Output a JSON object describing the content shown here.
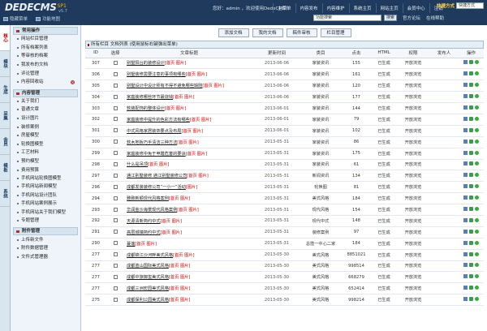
{
  "header": {
    "logo_text": "DEDECMS",
    "logo_version": "v5.7",
    "logo_badge": "SP1",
    "toggles": [
      {
        "label": "隐藏菜单"
      },
      {
        "label": "功能地图"
      }
    ],
    "welcome": "您好：admin ，欢迎使用DedeCMS！",
    "nav": [
      {
        "label": "主菜单"
      },
      {
        "label": "内容发布"
      },
      {
        "label": "内容维护"
      },
      {
        "label": "系统主页"
      },
      {
        "label": "网站主页"
      },
      {
        "label": "会员中心"
      },
      {
        "label": "注销"
      }
    ],
    "quick_label": "快捷方式",
    "quick_value": "快捷方式",
    "search_placeholder": "功能搜索",
    "search_button": "搜索",
    "links": [
      {
        "label": "官方论坛"
      },
      {
        "label": "在线帮助"
      }
    ]
  },
  "lefttabs": [
    {
      "label": "核心"
    },
    {
      "label": "模块"
    },
    {
      "label": "生成"
    },
    {
      "label": "采集"
    },
    {
      "label": "会员"
    },
    {
      "label": "模板"
    },
    {
      "label": "系统"
    }
  ],
  "sidebar": {
    "groups": [
      {
        "title": "常用操作",
        "items": [
          {
            "label": "网站栏目管理"
          },
          {
            "label": "所有档案列表"
          },
          {
            "label": "等审核的档案"
          },
          {
            "label": "我发布的文档"
          },
          {
            "label": "评论管理"
          },
          {
            "label": "内容回收站",
            "badge": "✕"
          }
        ]
      },
      {
        "title": "内容管理",
        "items": [
          {
            "label": "关于我们"
          },
          {
            "label": "普通文章"
          },
          {
            "label": "设计图片"
          },
          {
            "label": "装修案例"
          },
          {
            "label": "房屋模型"
          },
          {
            "label": "轮换图模型"
          },
          {
            "label": "工艺材料"
          },
          {
            "label": "预约模型"
          },
          {
            "label": "费用预算"
          },
          {
            "label": "手机网站轮换图模型"
          },
          {
            "label": "手机网站新闻模型"
          },
          {
            "label": "手机网站设计团队"
          },
          {
            "label": "手机网站案例展示"
          },
          {
            "label": "手机网站关于我们模型"
          },
          {
            "label": "专题管理"
          }
        ]
      },
      {
        "title": "附件管理",
        "items": [
          {
            "label": "上传新文件"
          },
          {
            "label": "附件数据管理"
          },
          {
            "label": "文件式管理器"
          }
        ]
      }
    ]
  },
  "toolbar": {
    "buttons": [
      {
        "label": "添加文档"
      },
      {
        "label": "我的文档"
      },
      {
        "label": "稿件审核"
      },
      {
        "label": "栏目管理"
      }
    ]
  },
  "caption": "所有栏目 文档列表  (使用鼠标右键弹出菜单)",
  "table": {
    "columns": [
      "ID",
      "选择",
      "文章标题",
      "更新时间",
      "类目",
      "点击",
      "HTML",
      "权限",
      "发布人",
      "操作"
    ],
    "rows": [
      {
        "id": "307",
        "title": "别墅阳台的装修设计",
        "tags": "[首页 图片]",
        "date": "2013-06-06",
        "cat": "家装资讯",
        "clicks": "155",
        "html": "已生成",
        "perm": "开放浏览"
      },
      {
        "id": "306",
        "title": "别墅装修需要注意的事项有哪些",
        "tags": "[首页 图片]",
        "date": "2013-06-06",
        "cat": "家装资讯",
        "clicks": "161",
        "html": "已生成",
        "perm": "开放浏览"
      },
      {
        "id": "305",
        "title": "别墅设计中设计师有不得不避免哪些缺陷",
        "tags": "[首页 图片]",
        "date": "2013-06-06",
        "cat": "家装资讯",
        "clicks": "120",
        "html": "已生成",
        "perm": "开放浏览"
      },
      {
        "id": "304",
        "title": "家庭装修哪些环节最烧钱",
        "tags": "[首页 图片]",
        "date": "2013-06-06",
        "cat": "家装资讯",
        "clicks": "177",
        "html": "已生成",
        "perm": "开放浏览"
      },
      {
        "id": "303",
        "title": "软装配饰的整体设计",
        "tags": "[首页 图片]",
        "date": "2013-06-01",
        "cat": "家装资讯",
        "clicks": "144",
        "html": "已生成",
        "perm": "开放浏览"
      },
      {
        "id": "302",
        "title": "家庭装修中提升的色彩方法有哪些",
        "tags": "[首页 图片]",
        "date": "2013-06-01",
        "cat": "家装资讯",
        "clicks": "79",
        "html": "已生成",
        "perm": "开放浏览"
      },
      {
        "id": "301",
        "title": "中式风格家居装饰要点及布局",
        "tags": "[首页 图片]",
        "date": "2013-06-01",
        "cat": "家装资讯",
        "clicks": "102",
        "html": "已生成",
        "perm": "开放浏览"
      },
      {
        "id": "300",
        "title": "软木地板巧手清洁三种方法",
        "tags": "[首页 图片]",
        "date": "2013-05-31",
        "cat": "家装资讯",
        "clicks": "86",
        "html": "已生成",
        "perm": "开放浏览"
      },
      {
        "id": "299",
        "title": "家庭装修中免于甲醛危害的要诀",
        "tags": "[首页 图片]",
        "date": "2013-05-31",
        "cat": "家装资讯",
        "clicks": "175",
        "html": "已生成",
        "perm": "开放浏览"
      },
      {
        "id": "298",
        "title": "什么是吊顶",
        "tags": "[首页 图片]",
        "date": "2013-05-31",
        "cat": "家装资讯",
        "clicks": "61",
        "html": "已生成",
        "perm": "开放浏览"
      },
      {
        "id": "297",
        "title": "通江别墅装修 通江别墅装修公司",
        "tags": "[首页 图片]",
        "date": "2013-05-31",
        "cat": "新闻资讯",
        "clicks": "134",
        "html": "已生成",
        "perm": "开放浏览"
      },
      {
        "id": "296",
        "title": "成都发装装修公司“一小一”活动",
        "tags": "[图片]",
        "date": "2013-05-31",
        "cat": "轮换图",
        "clicks": "81",
        "html": "已生成",
        "perm": "开放浏览"
      },
      {
        "id": "294",
        "title": "雅致新颖现代风格案例",
        "tags": "[首页 图片]",
        "date": "2013-05-31",
        "cat": "美式风格",
        "clicks": "184",
        "html": "已生成",
        "perm": "开放浏览"
      },
      {
        "id": "293",
        "title": "华润金沙海景现代风格案例",
        "tags": "[首页 图片]",
        "date": "2013-05-31",
        "cat": "现代风格",
        "clicks": "154",
        "html": "已生成",
        "perm": "开放浏览"
      },
      {
        "id": "292",
        "title": "天源清新简约中式",
        "tags": "[首页 图片]",
        "date": "2013-05-31",
        "cat": "现代中式",
        "clicks": "148",
        "html": "已生成",
        "perm": "开放浏览"
      },
      {
        "id": "291",
        "title": "高层城镇简约中式",
        "tags": "[首页 图片]",
        "date": "2013-05-31",
        "cat": "装修案例",
        "clicks": "97",
        "html": "已生成",
        "perm": "开放浏览"
      },
      {
        "id": "290",
        "title": "蔓莲",
        "tags": "[首页 图片]",
        "date": "2013-05-31",
        "cat": "总揽一中心二家",
        "clicks": "184",
        "html": "已生成",
        "perm": "开放浏览"
      },
      {
        "id": "277",
        "title": "成都锦江沙河畔美式风格",
        "tags": "[首页 图片]",
        "date": "2013-05-30",
        "cat": "美式风格",
        "clicks": "8851021",
        "html": "已生成",
        "perm": "开放浏览"
      },
      {
        "id": "277",
        "title": "成都蓝山国际美式风格",
        "tags": "[首页 图片]",
        "date": "2013-05-30",
        "cat": "美式风格",
        "clicks": "998514",
        "html": "已生成",
        "perm": "开放浏览"
      },
      {
        "id": "277",
        "title": "成都中旅御玺美式风格",
        "tags": "[首页 图片]",
        "date": "2013-05-30",
        "cat": "美式风格",
        "clicks": "668279",
        "html": "已生成",
        "perm": "开放浏览"
      },
      {
        "id": "277",
        "title": "成都三洲宏园美式风格",
        "tags": "[首页 图片]",
        "date": "2013-05-30",
        "cat": "美式风格",
        "clicks": "652414",
        "html": "已生成",
        "perm": "开放浏览"
      },
      {
        "id": "275",
        "title": "成都保利公园美式风格",
        "tags": "[首页 图片]",
        "date": "2013-05-30",
        "cat": "美式风格",
        "clicks": "998214",
        "html": "已生成",
        "perm": "开放浏览"
      }
    ]
  }
}
